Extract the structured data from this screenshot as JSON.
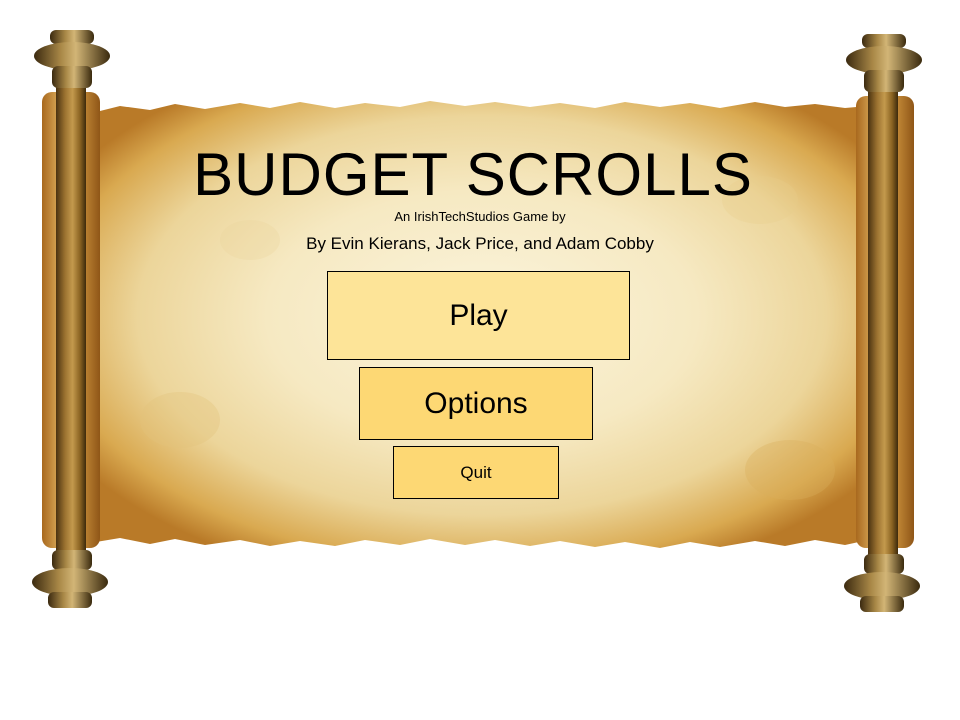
{
  "game": {
    "title": "BUDGET SCROLLS",
    "subtitle": "An IrishTechStudios Game by",
    "authors": "By Evin Kierans, Jack Price, and Adam Cobby"
  },
  "menu": {
    "play_label": "Play",
    "options_label": "Options",
    "quit_label": "Quit"
  },
  "colors": {
    "parchment_light": "#f8edc8",
    "parchment_dark": "#c98a2e",
    "rod_wood": "#8a6322",
    "play_button": "#fde498",
    "options_button": "#fdd874",
    "quit_button": "#fdd874"
  },
  "icons": {
    "background": "parchment-scroll",
    "left_rod": "wooden-scroll-rod",
    "right_rod": "wooden-scroll-rod"
  }
}
